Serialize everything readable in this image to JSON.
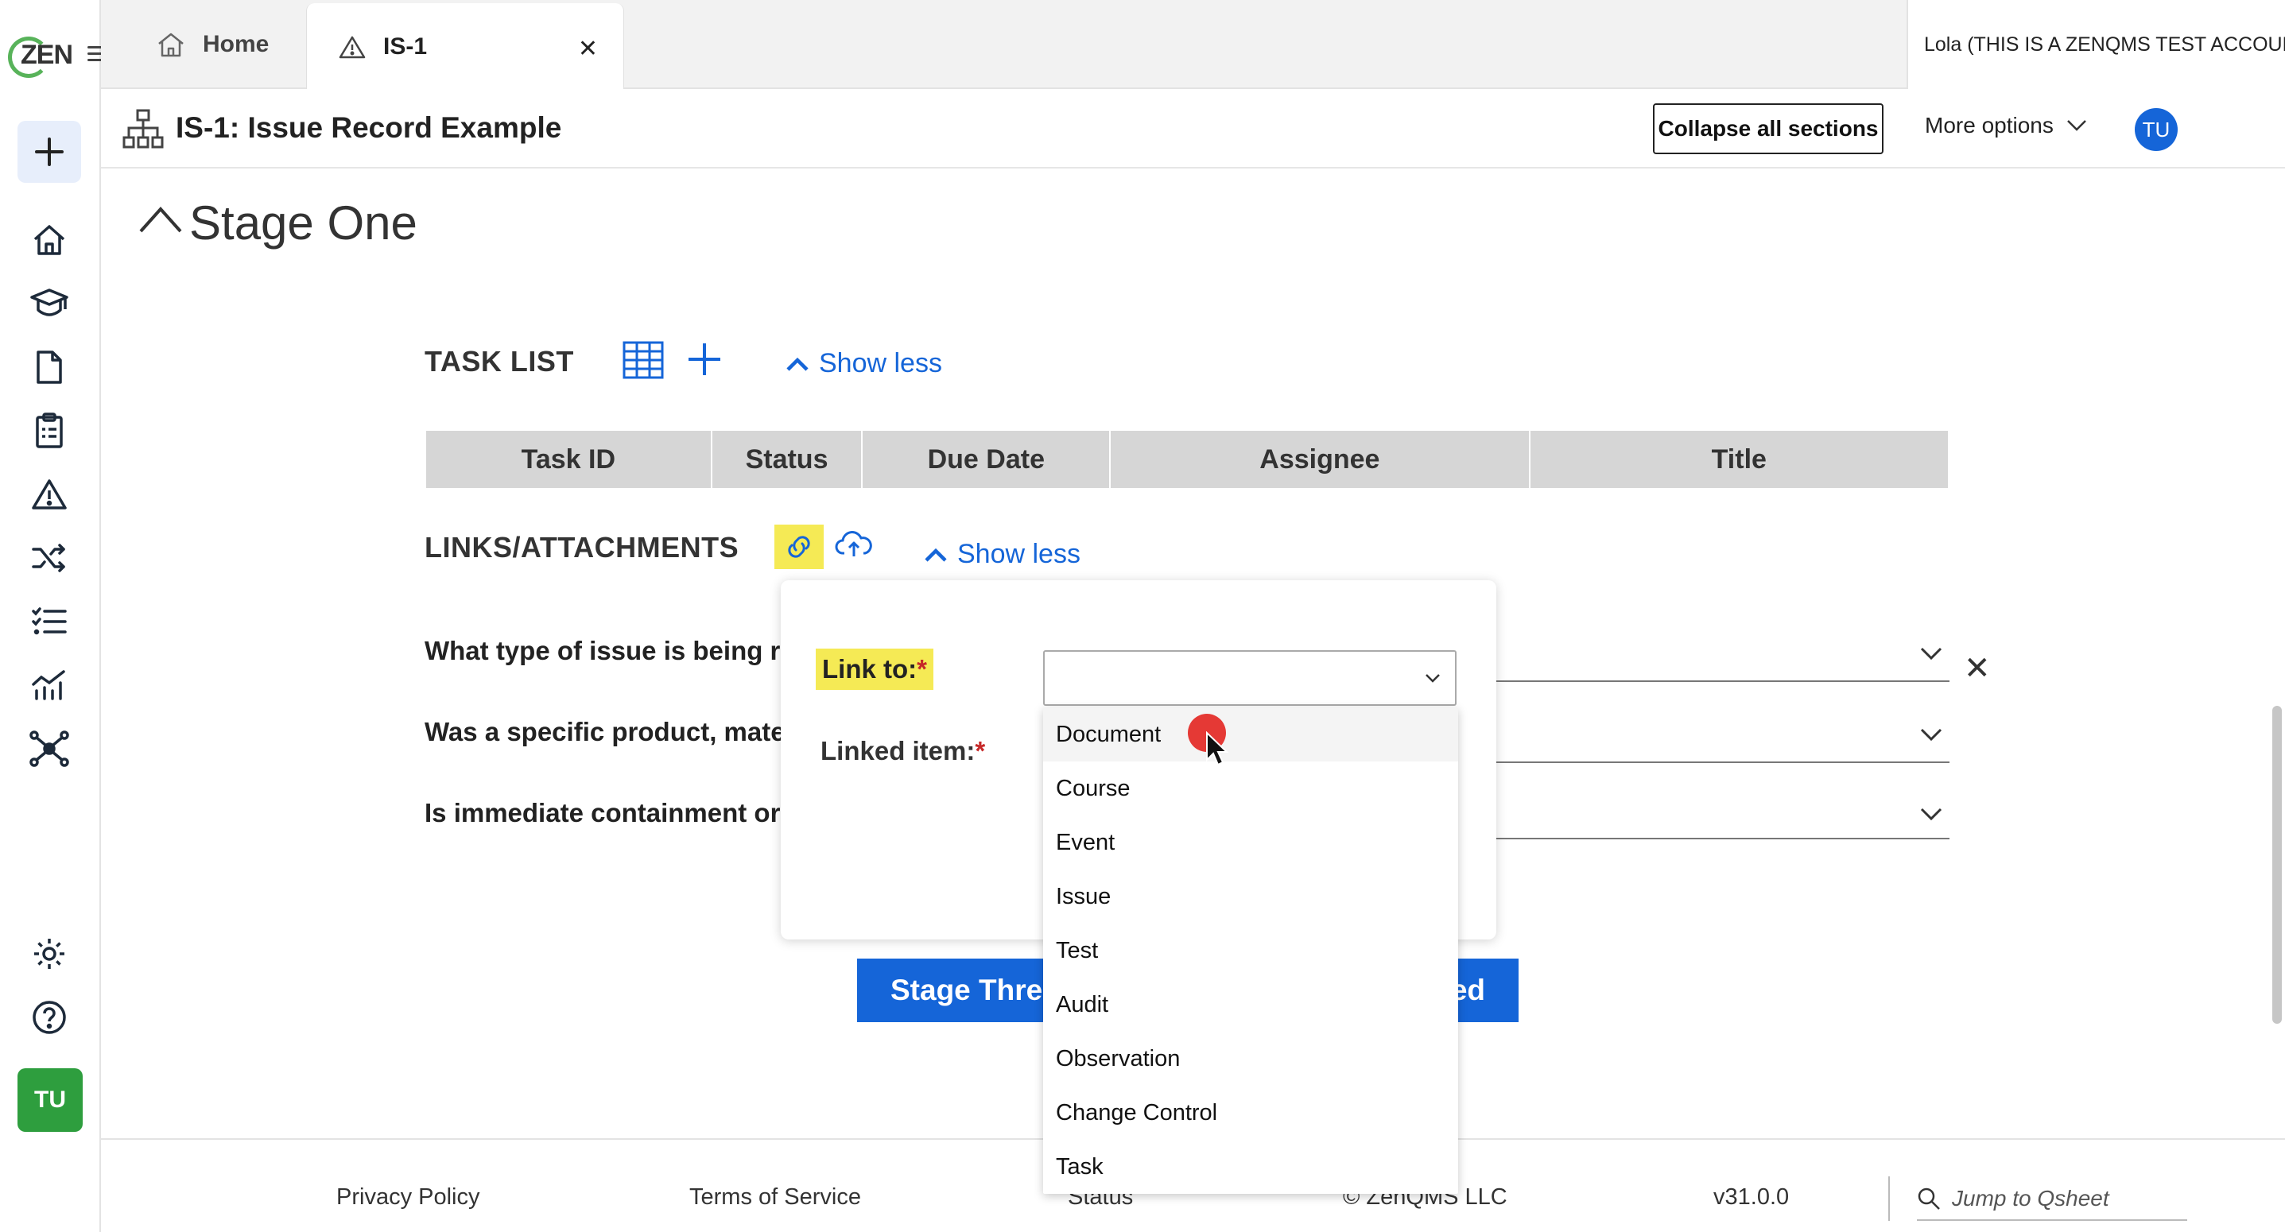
{
  "app": {
    "logo_text": "ZEN"
  },
  "tabs": [
    {
      "label": "Home"
    },
    {
      "label": "IS-1"
    }
  ],
  "account": {
    "name": "Lola (THIS IS A ZENQMS TEST ACCOUNT)"
  },
  "header": {
    "title": "IS-1: Issue Record Example",
    "collapse_label": "Collapse all sections",
    "more_options_label": "More options",
    "avatar_initials": "TU"
  },
  "rail": {
    "avatar_initials": "TU",
    "icons": [
      "plus-icon",
      "home-icon",
      "graduation-cap-icon",
      "document-icon",
      "clipboard-icon",
      "warning-icon",
      "shuffle-icon",
      "checklist-icon",
      "chart-icon",
      "network-icon",
      "gear-icon",
      "help-icon"
    ]
  },
  "stage": {
    "title": "Stage One"
  },
  "task_list": {
    "title": "TASK LIST",
    "show_less": "Show less",
    "columns": [
      "Task ID",
      "Status",
      "Due Date",
      "Assignee",
      "Title"
    ]
  },
  "links": {
    "title": "LINKS/ATTACHMENTS",
    "show_less": "Show less"
  },
  "questions": [
    "What type of issue is being rep",
    "Was a specific product, materi",
    "Is immediate containment or c"
  ],
  "stage_buttons": [
    "Stage Three",
    "ed"
  ],
  "popover": {
    "link_to_label": "Link to:",
    "linked_item_label": "Linked item:",
    "required_mark": "*",
    "selected_value": ""
  },
  "dropdown": {
    "options": [
      "Document",
      "Course",
      "Event",
      "Issue",
      "Test",
      "Audit",
      "Observation",
      "Change Control",
      "Task"
    ],
    "hovered_index": 0
  },
  "footer": {
    "privacy": "Privacy Policy",
    "terms": "Terms of Service",
    "status": "Status",
    "copyright": "© ZenQMS LLC",
    "version": "v31.0.0",
    "jump_placeholder": "Jump to Qsheet"
  },
  "colors": {
    "accent": "#1565d8",
    "highlight": "#f5ea55",
    "brand_green": "#2e9e3e",
    "required": "#c62828"
  }
}
